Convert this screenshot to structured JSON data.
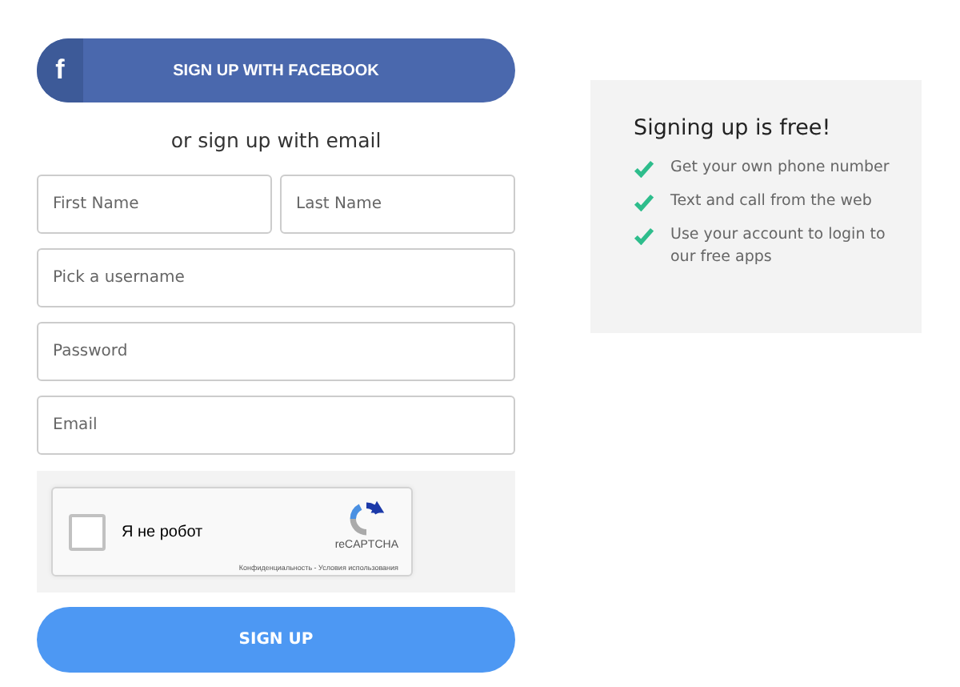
{
  "facebook_button": {
    "icon": "f",
    "label": "SIGN UP WITH FACEBOOK"
  },
  "divider_text": "or sign up with email",
  "fields": [
    {
      "placeholder": "First Name"
    },
    {
      "placeholder": "Last Name"
    },
    {
      "placeholder": "Pick a username"
    },
    {
      "placeholder": "Password"
    },
    {
      "placeholder": "Email"
    }
  ],
  "captcha": {
    "checked": false,
    "label": "Я не робот",
    "brand": "reCAPTCHA",
    "footer": "Конфиденциальность - Условия использования"
  },
  "submit_button": "SIGN UP",
  "info_panel": {
    "title": "Signing up is free!",
    "items": [
      "Get your own phone number",
      "Text and call from the web",
      "Use your account to login to our free apps"
    ]
  }
}
